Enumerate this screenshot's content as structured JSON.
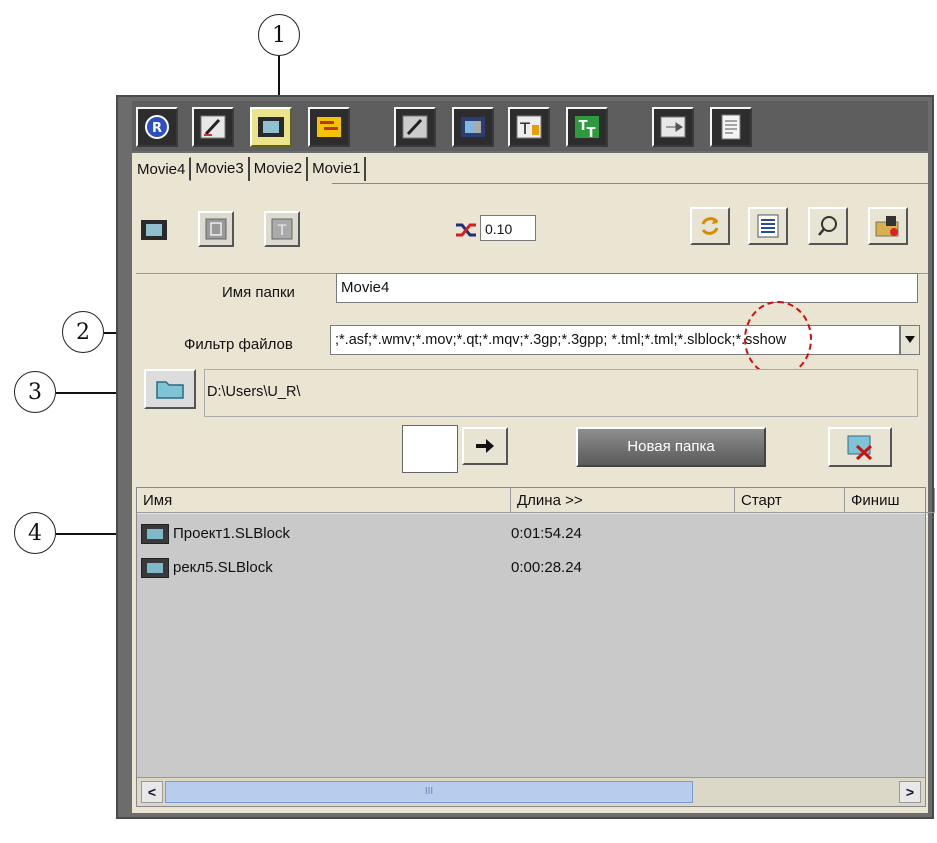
{
  "callouts": [
    "1",
    "2",
    "3",
    "4"
  ],
  "tabs": [
    "Movie4",
    "Movie3",
    "Movie2",
    "Movie1"
  ],
  "speed_value": "0.10",
  "folder_name": {
    "label": "Имя папки",
    "value": "Movie4"
  },
  "file_filter": {
    "label": "Фильтр файлов",
    "value": ";*.asf;*.wmv;*.mov;*.qt;*.mqv;*.3gp;*.3gpp; *.tml;*.tml;*.slblock;*.sshow"
  },
  "path": "D:\\Users\\U_R\\",
  "new_folder_button": "Новая папка",
  "columns": [
    "Имя",
    "Длина >>",
    "Старт",
    "Финиш"
  ],
  "files": [
    {
      "name": "Проект1.SLBlock",
      "length": "0:01:54.24"
    },
    {
      "name": "рекл5.SLBlock",
      "length": "0:00:28.24"
    }
  ],
  "scroll_grip": "III",
  "colors": {
    "highlight_circle": "#cc1111",
    "active_toolbar": "#ece48a",
    "panel": "#eae5d3"
  }
}
